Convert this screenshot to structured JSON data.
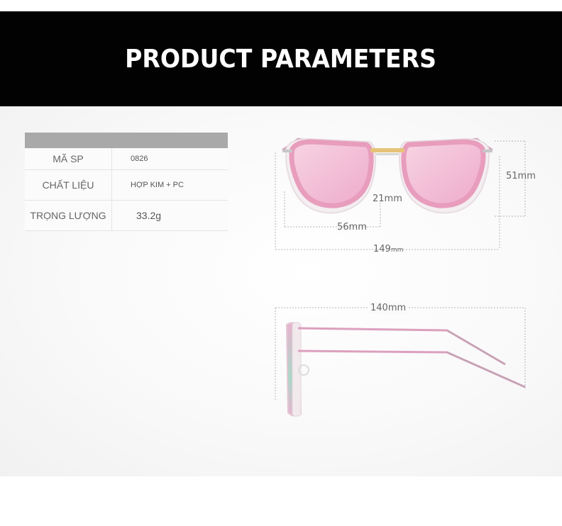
{
  "banner": {
    "title": "PRODUCT PARAMETERS"
  },
  "specs": [
    {
      "label": "MÃ SP",
      "value": "0826"
    },
    {
      "label": "CHẤT LIỆU",
      "value": "HỢP KIM + PC"
    },
    {
      "label": "TRỌNG LƯỢNG",
      "value": "33.2g"
    }
  ],
  "front_view": {
    "lens_height": "51mm",
    "bridge_width": "21mm",
    "lens_width": "56mm",
    "frame_width_number": "149",
    "frame_width_unit": "mm"
  },
  "side_view": {
    "temple_length": "140mm"
  },
  "colors": {
    "banner": "#020202",
    "lens": "#f3bfd3",
    "frame": "#e79cbc",
    "accent": "#e6c37a"
  }
}
